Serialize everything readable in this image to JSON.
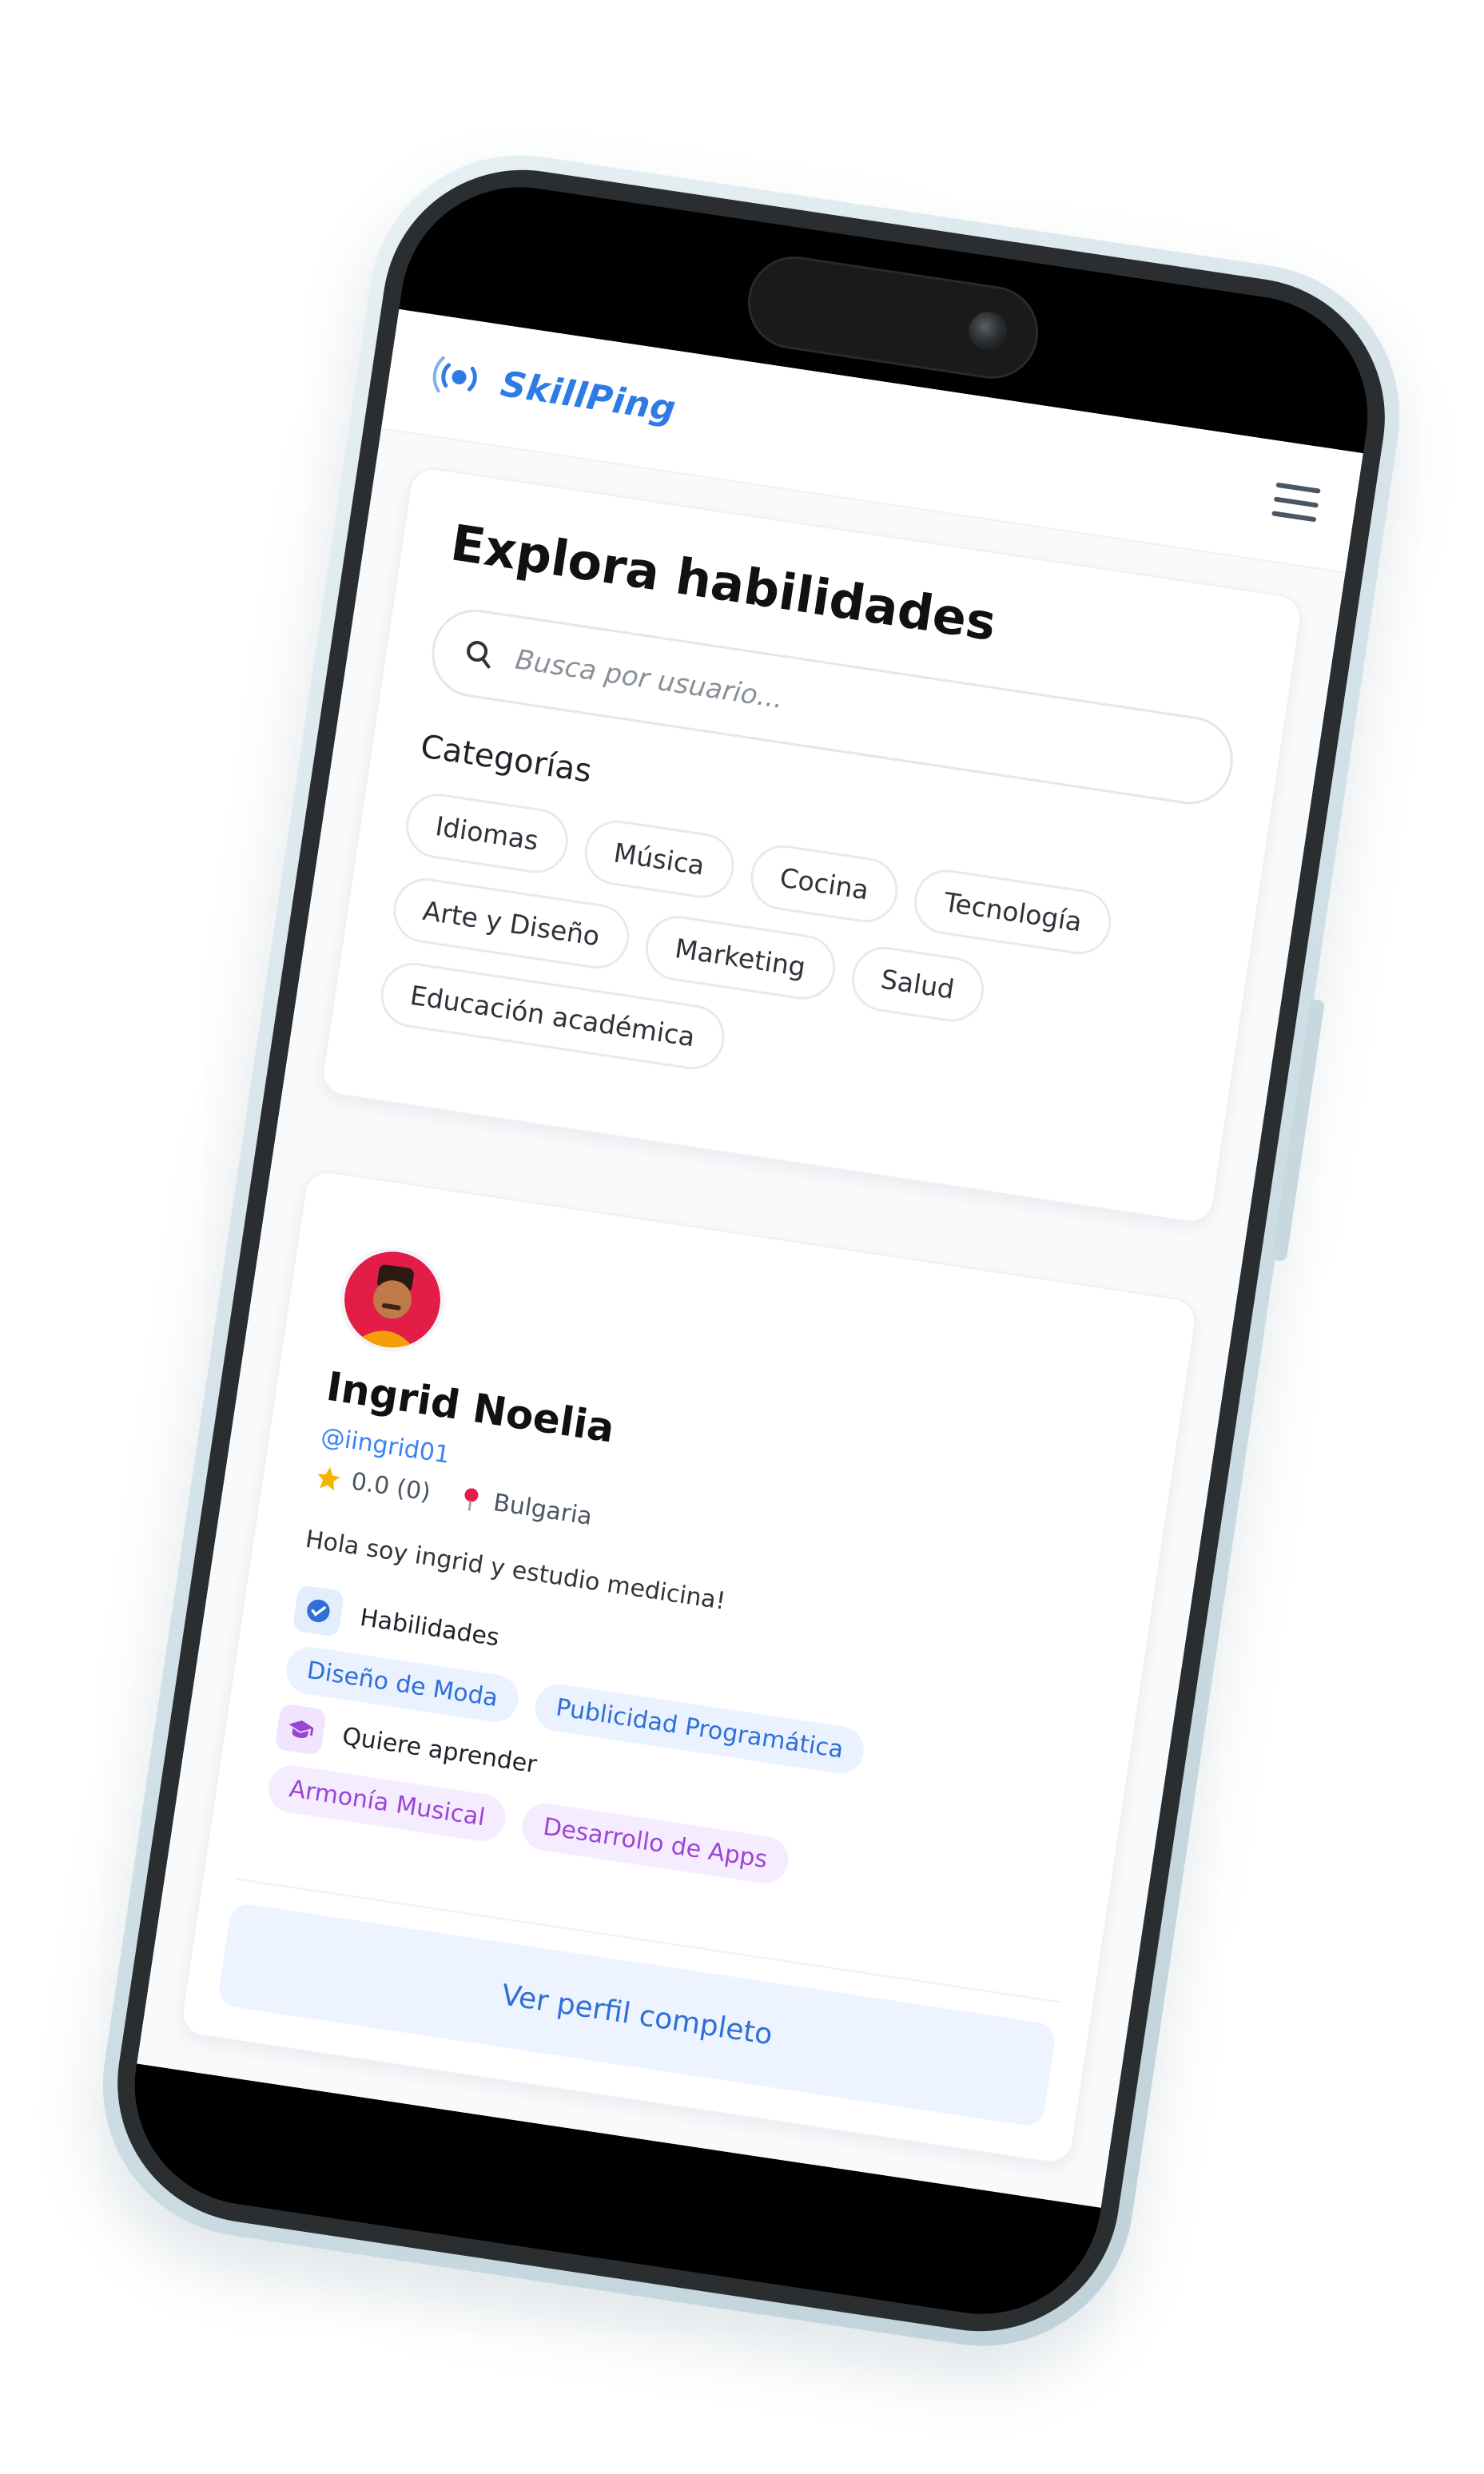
{
  "app": {
    "brand_name": "SkillPing",
    "brand_icon": "signal-ping-icon",
    "menu_icon": "hamburger-menu-icon",
    "accent_color": "#2f7be6"
  },
  "explore": {
    "title": "Explora habilidades",
    "search": {
      "placeholder": "Busca por usuario..."
    },
    "categories_title": "Categorías",
    "categories": [
      "Idiomas",
      "Música",
      "Cocina",
      "Tecnología",
      "Arte y Diseño",
      "Marketing",
      "Salud",
      "Educación académica"
    ]
  },
  "user_card": {
    "name": "Ingrid Noelia",
    "handle": "@iingrid01",
    "rating": "0.0 (0)",
    "location": "Bulgaria",
    "bio": "Hola soy ingrid y estudio medicina!",
    "teaches_label": "Habilidades",
    "teaches": [
      "Diseño de Moda",
      "Publicidad Programática"
    ],
    "learns_label": "Quiere aprender",
    "learns": [
      "Armonía Musical",
      "Desarrollo de Apps"
    ],
    "profile_button": "Ver perfil completo",
    "teach_color": "#2f6fd6",
    "learn_color": "#9b45d6"
  }
}
